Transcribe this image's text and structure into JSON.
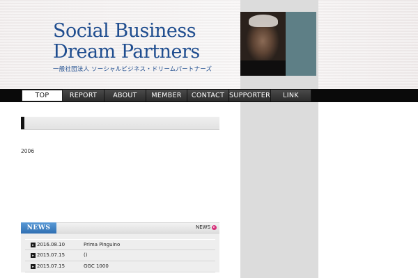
{
  "header": {
    "logo_line1": "Social Business",
    "logo_line2": "Dream Partners",
    "logo_sub": "一般社団法人 ソーシャルビジネス・ドリームパートナーズ"
  },
  "nav": {
    "items": [
      {
        "label": "TOP",
        "active": true
      },
      {
        "label": "REPORT"
      },
      {
        "label": "ABOUT"
      },
      {
        "label": "MEMBER"
      },
      {
        "label": "CONTACT"
      },
      {
        "label": "SUPPORTER"
      },
      {
        "label": "LINK"
      }
    ]
  },
  "main": {
    "body_text": "2006"
  },
  "news": {
    "heading": "NEWS",
    "more_label": "NEWS",
    "items": [
      {
        "date": "2016.08.10",
        "title": "Prima Pinguino"
      },
      {
        "date": "2015.07.15",
        "title": "()"
      },
      {
        "date": "2015.07.15",
        "title": "GGC  1000"
      }
    ]
  },
  "colors": {
    "brand_blue": "#1f4d8f",
    "nav_bg": "#0a0a0a",
    "news_tab": "#3f82c4",
    "accent_pink": "#d6307a"
  }
}
